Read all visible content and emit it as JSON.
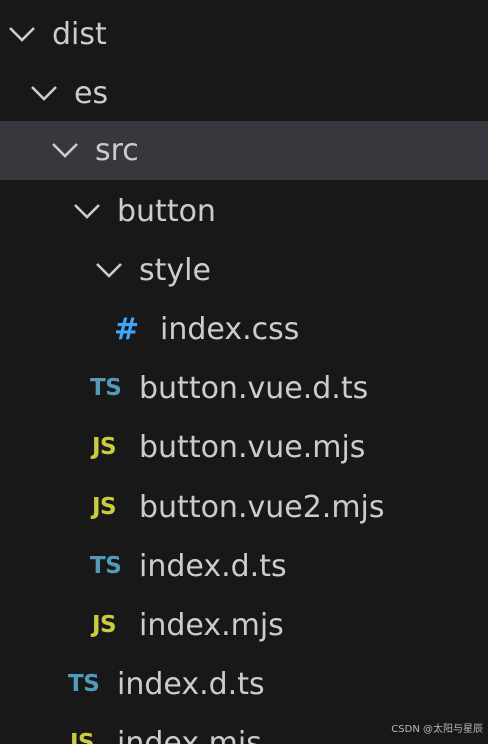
{
  "explorer": {
    "items": [
      {
        "label": "dist",
        "kind": "folder",
        "expanded": true
      },
      {
        "label": "es",
        "kind": "folder",
        "expanded": true
      },
      {
        "label": "src",
        "kind": "folder",
        "expanded": true,
        "selected": true
      },
      {
        "label": "button",
        "kind": "folder",
        "expanded": true
      },
      {
        "label": "style",
        "kind": "folder",
        "expanded": true
      },
      {
        "label": "index.css",
        "kind": "file",
        "icon_text": "#"
      },
      {
        "label": "button.vue.d.ts",
        "kind": "file",
        "icon_text": "TS"
      },
      {
        "label": "button.vue.mjs",
        "kind": "file",
        "icon_text": "JS"
      },
      {
        "label": "button.vue2.mjs",
        "kind": "file",
        "icon_text": "JS"
      },
      {
        "label": "index.d.ts",
        "kind": "file",
        "icon_text": "TS"
      },
      {
        "label": "index.mjs",
        "kind": "file",
        "icon_text": "JS"
      },
      {
        "label": "index.d.ts",
        "kind": "file",
        "icon_text": "TS"
      },
      {
        "label": "index.mjs",
        "kind": "file",
        "icon_text": "JS"
      }
    ]
  },
  "watermark": "CSDN @太阳与星辰",
  "colors": {
    "background": "#181818",
    "selected_row": "#37373d",
    "text": "#cccccc",
    "ts_icon": "#519aba",
    "js_icon": "#cbcb41",
    "css_icon": "#42a5f5"
  }
}
